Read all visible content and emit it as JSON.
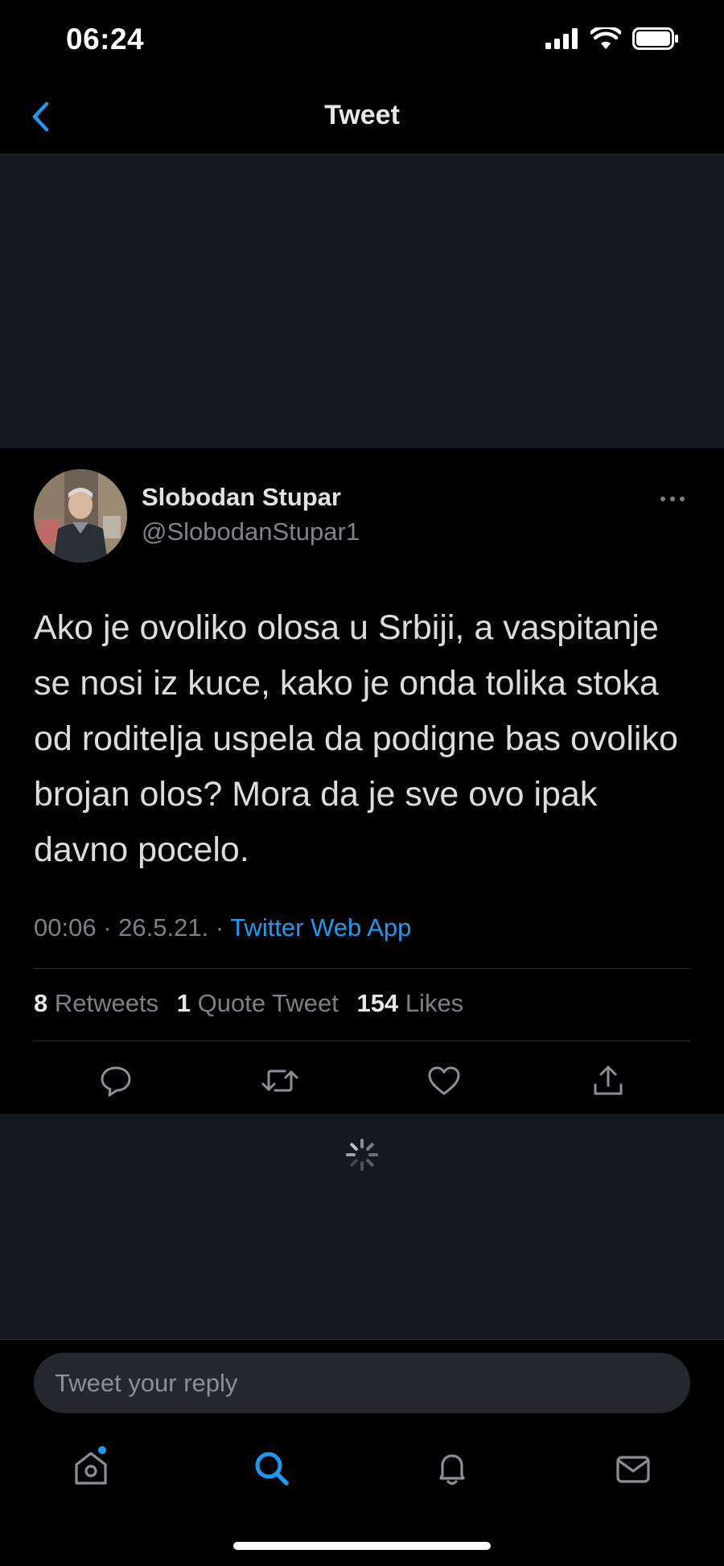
{
  "status_bar": {
    "time": "06:24",
    "battery_level": 1.0
  },
  "nav": {
    "title": "Tweet",
    "back_icon": "chevron-left-icon"
  },
  "tweet": {
    "author_name": "Slobodan Stupar",
    "author_handle": "@SlobodanStupar1",
    "text": "Ako je ovoliko olosa u Srbiji, a vaspitanje se nosi iz kuce, kako je onda tolika stoka od roditelja uspela da podigne bas ovoliko brojan olos? Mora da je sve ovo ipak davno pocelo.",
    "time": "00:06",
    "date": "26.5.21.",
    "source": "Twitter Web App",
    "retweets_count": "8",
    "retweets_label": "Retweets",
    "quotes_count": "1",
    "quotes_label": "Quote Tweet",
    "likes_count": "154",
    "likes_label": "Likes"
  },
  "actions": [
    "reply-icon",
    "retweet-icon",
    "like-icon",
    "share-icon"
  ],
  "reply": {
    "placeholder": "Tweet your reply"
  },
  "tab_bar": [
    "home-icon",
    "search-icon",
    "notifications-icon",
    "messages-icon"
  ],
  "colors": {
    "accent": "#1d9bf0",
    "background": "#000000",
    "panel": "#15181c",
    "muted": "#7c8186"
  }
}
